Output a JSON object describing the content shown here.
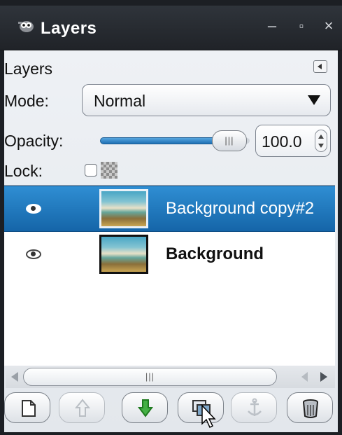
{
  "window": {
    "title": "Layers",
    "minimize_glyph": "–",
    "maximize_glyph": "▫",
    "close_glyph": "×"
  },
  "panel": {
    "tab_label": "Layers",
    "mode_label": "Mode:",
    "mode_value": "Normal",
    "opacity_label": "Opacity:",
    "opacity_value": "100.0",
    "opacity_percent": 100,
    "lock_label": "Lock:",
    "lock_pixels_checked": false
  },
  "layers": [
    {
      "name": "Background copy#2",
      "visible": true,
      "selected": true
    },
    {
      "name": "Background",
      "visible": true,
      "selected": false
    }
  ],
  "scrollbar": {
    "thumb_grip": "|||"
  },
  "slider": {
    "knob_grip": "|||"
  },
  "buttons": [
    {
      "name": "new-layer",
      "icon": "page-icon",
      "enabled": true
    },
    {
      "name": "raise-layer",
      "icon": "arrow-up-icon",
      "enabled": false
    },
    {
      "name": "lower-layer",
      "icon": "arrow-down-icon",
      "enabled": true
    },
    {
      "name": "duplicate-layer",
      "icon": "duplicate-icon",
      "enabled": true
    },
    {
      "name": "anchor-layer",
      "icon": "anchor-icon",
      "enabled": false
    },
    {
      "name": "delete-layer",
      "icon": "trash-icon",
      "enabled": true
    }
  ],
  "colors": {
    "selection": "#1f78c1",
    "titlebar": "#262a30",
    "lower_arrow": "#3aa43a"
  }
}
